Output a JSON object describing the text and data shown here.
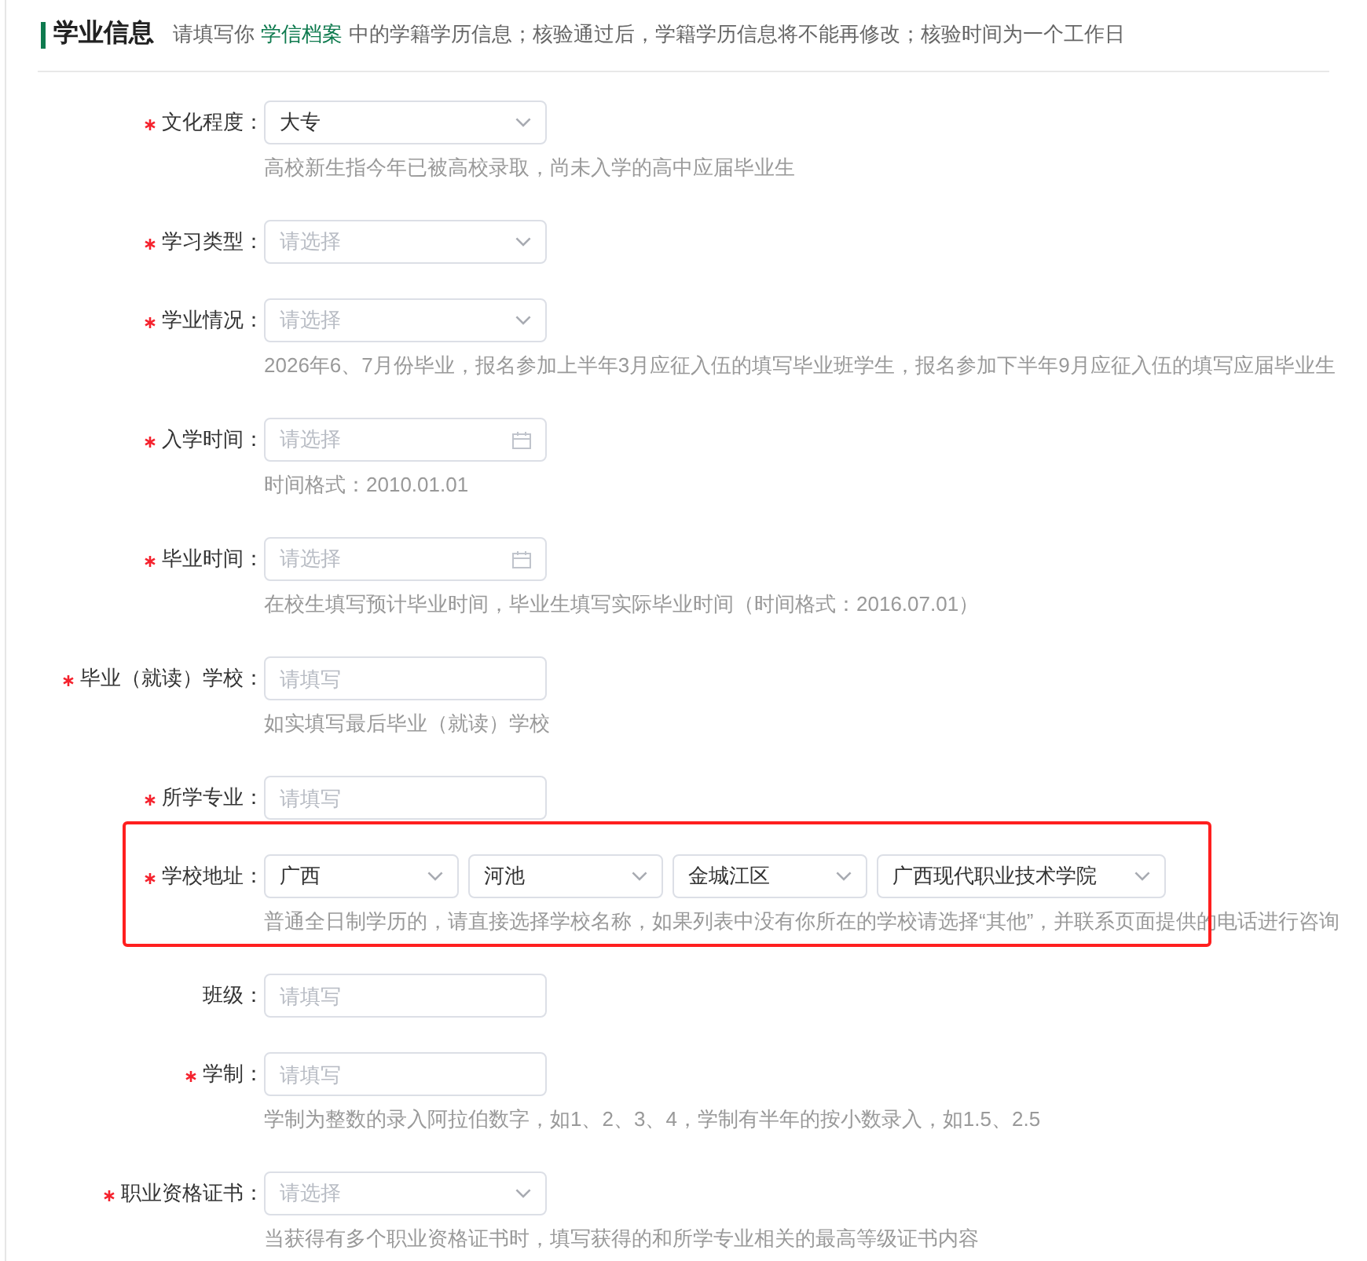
{
  "section": {
    "title": "学业信息",
    "description": {
      "before": "请填写你",
      "link": "学信档案",
      "after": "中的学籍学历信息；核验通过后，学籍学历信息将不能再修改；核验时间为一个工作日"
    }
  },
  "fields": [
    {
      "label": "文化程度：",
      "required": true,
      "highlighted": false,
      "kind": "select",
      "value": "大专",
      "hint": "高校新生指今年已被高校录取，尚未入学的高中应届毕业生"
    },
    {
      "label": "学习类型：",
      "required": true,
      "highlighted": false,
      "kind": "select",
      "placeholder": "请选择"
    },
    {
      "label": "学业情况：",
      "required": true,
      "highlighted": false,
      "kind": "select",
      "placeholder": "请选择",
      "hint": "2026年6、7月份毕业，报名参加上半年3月应征入伍的填写毕业班学生，报名参加下半年9月应征入伍的填写应届毕业生"
    },
    {
      "label": "入学时间：",
      "required": true,
      "highlighted": false,
      "kind": "date",
      "placeholder": "请选择",
      "hint": "时间格式：2010.01.01"
    },
    {
      "label": "毕业时间：",
      "required": true,
      "highlighted": false,
      "kind": "date",
      "placeholder": "请选择",
      "hint": "在校生填写预计毕业时间，毕业生填写实际毕业时间（时间格式：2016.07.01）"
    },
    {
      "label": "毕业（就读）学校：",
      "required": true,
      "highlighted": false,
      "kind": "text",
      "placeholder": "请填写",
      "hint": "如实填写最后毕业（就读）学校"
    },
    {
      "label": "所学专业：",
      "required": true,
      "highlighted": false,
      "kind": "text",
      "placeholder": "请填写"
    },
    {
      "label": "学校地址：",
      "required": true,
      "highlighted": true,
      "kind": "select_group",
      "selects": [
        {
          "value": "广西"
        },
        {
          "value": "河池"
        },
        {
          "value": "金城江区"
        },
        {
          "value": "广西现代职业技术学院"
        }
      ],
      "hint": "普通全日制学历的，请直接选择学校名称，如果列表中没有你所在的学校请选择“其他”，并联系页面提供的电话进行咨询"
    },
    {
      "label": "班级：",
      "required": false,
      "highlighted": false,
      "kind": "text",
      "placeholder": "请填写"
    },
    {
      "label": "学制：",
      "required": true,
      "highlighted": false,
      "kind": "text",
      "placeholder": "请填写",
      "hint": "学制为整数的录入阿拉伯数字，如1、2、3、4，学制有半年的按小数录入，如1.5、2.5"
    },
    {
      "label": "职业资格证书：",
      "required": true,
      "highlighted": false,
      "kind": "select",
      "placeholder": "请选择",
      "hint": "当获得有多个职业资格证书时，填写获得的和所学专业相关的最高等级证书内容"
    }
  ]
}
